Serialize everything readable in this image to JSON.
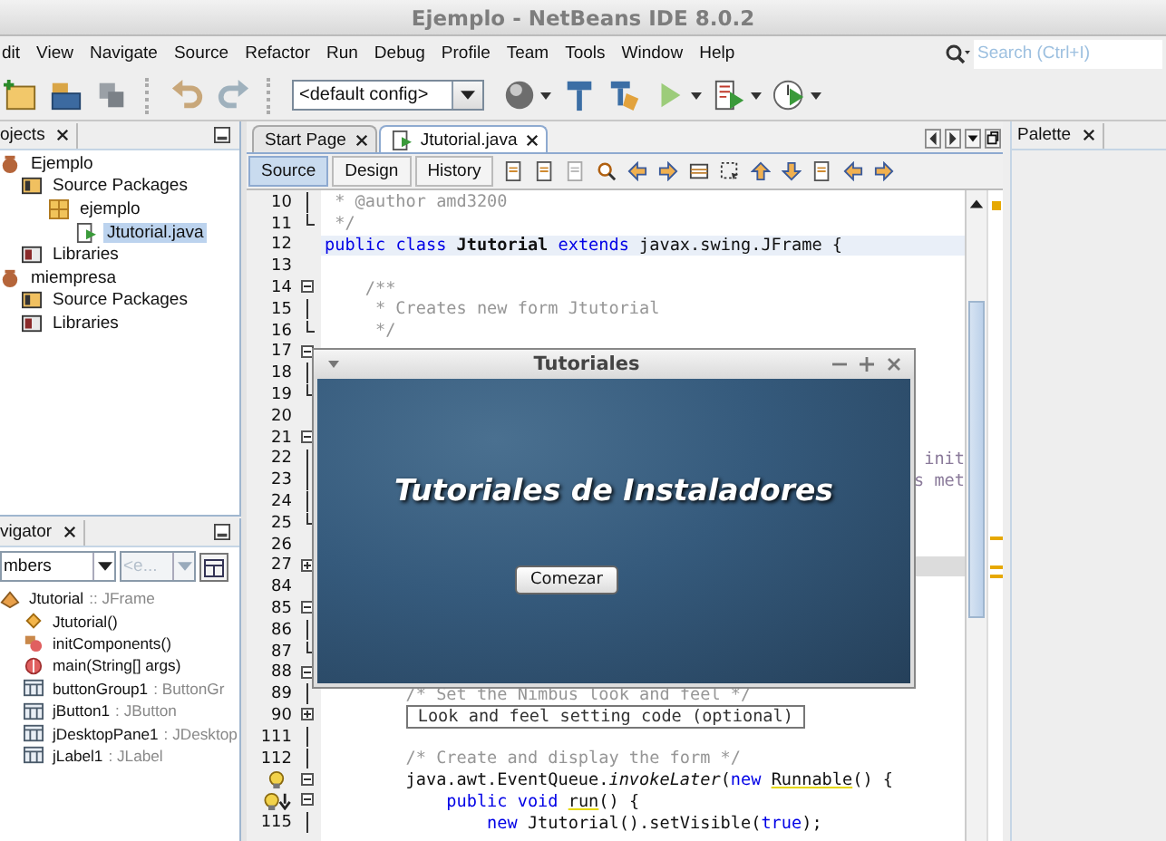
{
  "window": {
    "title": "Ejemplo - NetBeans IDE 8.0.2"
  },
  "menu": [
    "dit",
    "View",
    "Navigate",
    "Source",
    "Refactor",
    "Run",
    "Debug",
    "Profile",
    "Team",
    "Tools",
    "Window",
    "Help"
  ],
  "search": {
    "placeholder": "Search (Ctrl+I)"
  },
  "toolbar": {
    "config": "<default config>"
  },
  "projects_panel": {
    "title": "ojects",
    "tree": [
      {
        "label": "Ejemplo",
        "kind": "project",
        "selected": false,
        "children": [
          {
            "label": "Source Packages",
            "kind": "source-packages",
            "selected": false,
            "children": [
              {
                "label": "ejemplo",
                "kind": "package",
                "selected": false,
                "children": [
                  {
                    "label": "Jtutorial.java",
                    "kind": "java-file",
                    "selected": true
                  }
                ]
              }
            ]
          },
          {
            "label": "Libraries",
            "kind": "libraries",
            "selected": false
          }
        ]
      },
      {
        "label": "miempresa",
        "kind": "project",
        "selected": false,
        "children": [
          {
            "label": "Source Packages",
            "kind": "source-packages",
            "selected": false
          },
          {
            "label": "Libraries",
            "kind": "libraries",
            "selected": false
          }
        ]
      }
    ]
  },
  "navigator_panel": {
    "title": "vigator",
    "filter": {
      "value": "mbers",
      "disabled": false
    },
    "secondary_filter": {
      "value": "<e...",
      "disabled": true
    },
    "tree": [
      {
        "name": "Jtutorial",
        "type": ":: JFrame",
        "kind": "class",
        "children": [
          {
            "name": "Jtutorial()",
            "kind": "constructor"
          },
          {
            "name": "initComponents()",
            "kind": "private-method"
          },
          {
            "name": "main(String[] args)",
            "kind": "static-method"
          },
          {
            "name": "buttonGroup1",
            "type": ": ButtonGr",
            "kind": "field"
          },
          {
            "name": "jButton1",
            "type": ": JButton",
            "kind": "field"
          },
          {
            "name": "jDesktopPane1",
            "type": ": JDesktop",
            "kind": "field"
          },
          {
            "name": "jLabel1",
            "type": ": JLabel",
            "kind": "field"
          }
        ]
      }
    ]
  },
  "editor": {
    "tabs": [
      {
        "label": "Start Page",
        "selected": false
      },
      {
        "label": "Jtutorial.java",
        "selected": true
      }
    ],
    "views": [
      {
        "label": "Source",
        "selected": true
      },
      {
        "label": "Design",
        "selected": false
      },
      {
        "label": "History",
        "selected": false
      }
    ],
    "lines": [
      {
        "number": "10",
        "fold": {
          "kind": "inside"
        },
        "segments": [
          {
            "text": " * @author amd3200",
            "kind": "comment"
          }
        ]
      },
      {
        "number": "11",
        "fold": {
          "kind": "close"
        },
        "segments": [
          {
            "text": " */",
            "kind": "comment"
          }
        ]
      },
      {
        "number": "12",
        "highlight": {
          "kind": "caret"
        },
        "segments": [
          {
            "text": "public ",
            "kind": "keyword"
          },
          {
            "text": "class ",
            "kind": "keyword"
          },
          {
            "text": "Jtutorial ",
            "kind": "bold"
          },
          {
            "text": "extends ",
            "kind": "keyword"
          },
          {
            "text": "javax.swing.JFrame {",
            "kind": "code"
          }
        ]
      },
      {
        "number": "13"
      },
      {
        "number": "14",
        "fold": {
          "kind": "open"
        },
        "segments": [
          {
            "text": "    /**",
            "kind": "comment"
          }
        ]
      },
      {
        "number": "15",
        "fold": {
          "kind": "inside"
        },
        "segments": [
          {
            "text": "     * Creates new form Jtutorial",
            "kind": "comment"
          }
        ]
      },
      {
        "number": "16",
        "fold": {
          "kind": "close"
        },
        "segments": [
          {
            "text": "     */",
            "kind": "comment"
          }
        ]
      },
      {
        "number": "17",
        "fold": {
          "kind": "open"
        }
      },
      {
        "number": "18",
        "fold": {
          "kind": "inside"
        }
      },
      {
        "number": "19",
        "fold": {
          "kind": "close"
        }
      },
      {
        "number": "20"
      },
      {
        "number": "21",
        "fold": {
          "kind": "open"
        }
      },
      {
        "number": "22",
        "fold": {
          "kind": "inside"
        },
        "tail": "init"
      },
      {
        "number": "23",
        "fold": {
          "kind": "inside"
        },
        "tail": "s met"
      },
      {
        "number": "24",
        "fold": {
          "kind": "inside"
        }
      },
      {
        "number": "25",
        "fold": {
          "kind": "close"
        }
      },
      {
        "number": "26"
      },
      {
        "number": "27",
        "fold": {
          "kind": "collapsed"
        },
        "highlight": {
          "kind": "folded"
        }
      },
      {
        "number": "84"
      },
      {
        "number": "85",
        "fold": {
          "kind": "open"
        }
      },
      {
        "number": "86",
        "fold": {
          "kind": "inside"
        }
      },
      {
        "number": "87",
        "fold": {
          "kind": "close"
        }
      },
      {
        "number": "88",
        "fold": {
          "kind": "open"
        }
      },
      {
        "number": "89",
        "fold": {
          "kind": "inside"
        },
        "segments": [
          {
            "text": "        /* Set the Nimbus look and feel */",
            "kind": "comment"
          }
        ]
      },
      {
        "number": "90",
        "fold": {
          "kind": "collapsed"
        },
        "segments": [
          {
            "text": "Look and feel setting code (optional)",
            "kind": "folded"
          }
        ]
      },
      {
        "number": "111",
        "fold": {
          "kind": "inside"
        }
      },
      {
        "number": "112",
        "fold": {
          "kind": "inside"
        },
        "segments": [
          {
            "text": "        /* Create and display the form */",
            "kind": "comment"
          }
        ]
      },
      {
        "badge": {
          "kind": "hint"
        },
        "fold": {
          "kind": "open"
        },
        "segments": [
          {
            "text": "        java.awt.EventQueue.",
            "kind": "code"
          },
          {
            "text": "invokeLater",
            "kind": "italic"
          },
          {
            "text": "(",
            "kind": "code"
          },
          {
            "text": "new ",
            "kind": "keyword"
          },
          {
            "text": "Runnable",
            "kind": "warning"
          },
          {
            "text": "() {",
            "kind": "code"
          }
        ]
      },
      {
        "badge": {
          "kind": "hint-arrow"
        },
        "fold": {
          "kind": "open"
        },
        "segments": [
          {
            "text": "            public ",
            "kind": "keyword"
          },
          {
            "text": "void ",
            "kind": "keyword"
          },
          {
            "text": "run",
            "kind": "warning"
          },
          {
            "text": "() {",
            "kind": "code"
          }
        ]
      },
      {
        "number": "115",
        "fold": {
          "kind": "inside"
        },
        "segments": [
          {
            "text": "                new",
            "kind": "keyword"
          },
          {
            "text": " Jtutorial().setVisible(",
            "kind": "code"
          },
          {
            "text": "true",
            "kind": "keyword"
          },
          {
            "text": ");",
            "kind": "code"
          }
        ]
      }
    ]
  },
  "dialog": {
    "title": "Tutoriales",
    "heading": "Tutoriales de Instaladores",
    "button": "Comezar"
  },
  "palette": {
    "title": "Palette"
  }
}
